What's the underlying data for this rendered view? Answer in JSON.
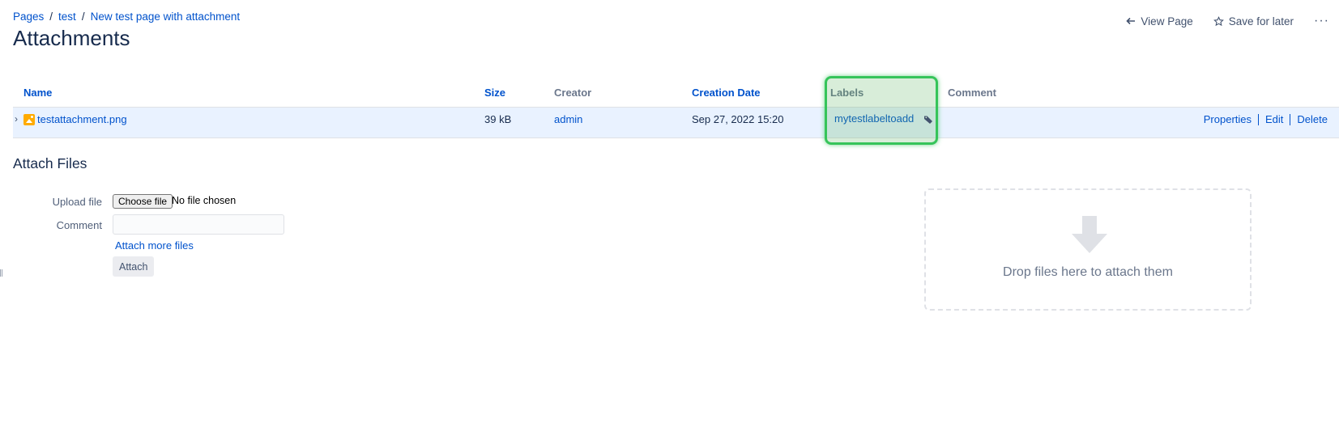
{
  "breadcrumb": {
    "items": [
      "Pages",
      "test",
      "New test page with attachment"
    ],
    "separator": "/"
  },
  "page_title": "Attachments",
  "top_actions": {
    "view_page": "View Page",
    "save_for_later": "Save for later",
    "more": "···"
  },
  "table": {
    "headers": {
      "name": "Name",
      "size": "Size",
      "creator": "Creator",
      "creation_date": "Creation Date",
      "labels": "Labels",
      "comment": "Comment"
    },
    "rows": [
      {
        "name": "testattachment.png",
        "size": "39 kB",
        "creator": "admin",
        "creation_date": "Sep 27, 2022 15:20",
        "label": "mytestlabeltoadd",
        "comment": "",
        "actions": {
          "properties": "Properties",
          "edit": "Edit",
          "delete": "Delete"
        }
      }
    ]
  },
  "attach_section": {
    "title": "Attach Files",
    "upload_label": "Upload file",
    "choose_file": "Choose file",
    "file_status": "No file chosen",
    "comment_label": "Comment",
    "comment_value": "",
    "attach_more": "Attach more files",
    "attach_button": "Attach",
    "dropzone_text": "Drop files here to attach them"
  },
  "colors": {
    "link": "#0052cc",
    "row_highlight": "#e9f2ff",
    "label_highlight_border": "#36c45a"
  }
}
